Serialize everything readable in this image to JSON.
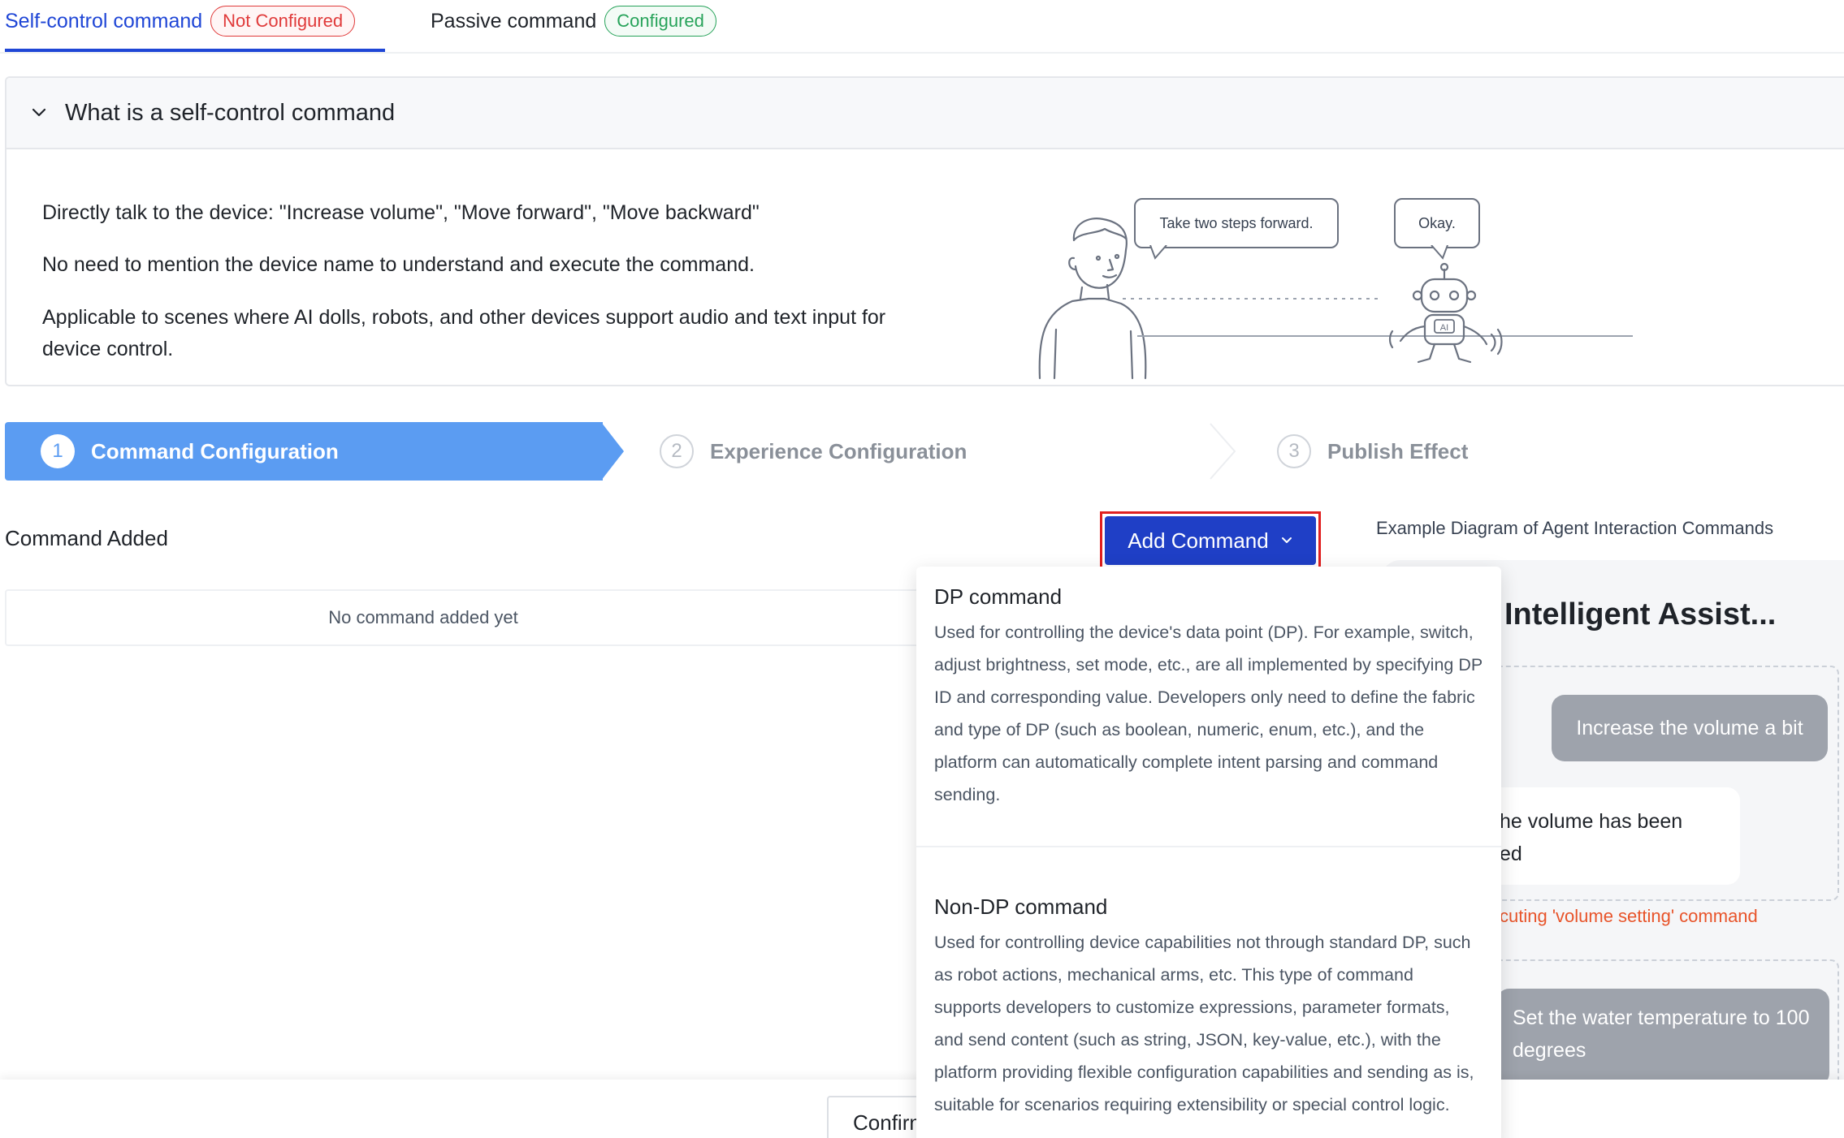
{
  "tabs": [
    {
      "label": "Self-control command",
      "badge": "Not Configured",
      "active": true
    },
    {
      "label": "Passive command",
      "badge": "Configured",
      "active": false
    }
  ],
  "intro": {
    "title": "What is a self-control command",
    "lines": [
      "Directly talk to the device: \"Increase volume\", \"Move forward\", \"Move backward\"",
      "No need to mention the device name to understand and execute the command.",
      "Applicable to scenes where AI dolls, robots, and other devices support audio and text input for",
      "device control."
    ],
    "illustration": {
      "human_bubble": "Take two steps forward.",
      "robot_bubble": "Okay.",
      "robot_chest": "AI"
    }
  },
  "steps": [
    {
      "num": "1",
      "label": "Command Configuration",
      "active": true
    },
    {
      "num": "2",
      "label": "Experience Configuration",
      "active": false
    },
    {
      "num": "3",
      "label": "Publish Effect",
      "active": false
    }
  ],
  "command": {
    "section_title": "Command Added",
    "empty_text": "No command added yet",
    "add_button": "Add Command"
  },
  "dropdown": {
    "items": [
      {
        "title": "DP command",
        "desc": "Used for controlling the device's data point (DP). For example, switch, adjust brightness, set mode, etc., are all implemented by specifying DP ID and corresponding value. Developers only need to define the fabric and type of DP (such as boolean, numeric, enum, etc.), and the platform can automatically complete intent parsing and command sending."
      },
      {
        "title": "Non-DP command",
        "desc": "Used for controlling device capabilities not through standard DP, such as robot actions, mechanical arms, etc. This type of command supports developers to customize expressions, parameter formats, and send content (such as string, JSON, key-value, etc.), with the platform providing flexible configuration capabilities and sending as is, suitable for scenarios requiring extensibility or special control logic."
      }
    ]
  },
  "example": {
    "title": "Example Diagram of Agent Interaction Commands",
    "assistant_title": "Intelligent Assist...",
    "user_msg_1": "Increase the volume a bit",
    "bot_reply": "he volume has been\ned",
    "exec_note": "cuting 'volume setting' command",
    "user_msg_2": "Set the water temperature to 100 degrees"
  },
  "footer": {
    "confirm": "Confirm"
  },
  "colors": {
    "primary": "#1f3fc6",
    "tab_active": "#1f46d6",
    "step_active": "#5b9cf2",
    "danger": "#e03a3a",
    "success": "#27a35a",
    "exec_note": "#e8542a",
    "highlight_outline": "#e02020"
  }
}
